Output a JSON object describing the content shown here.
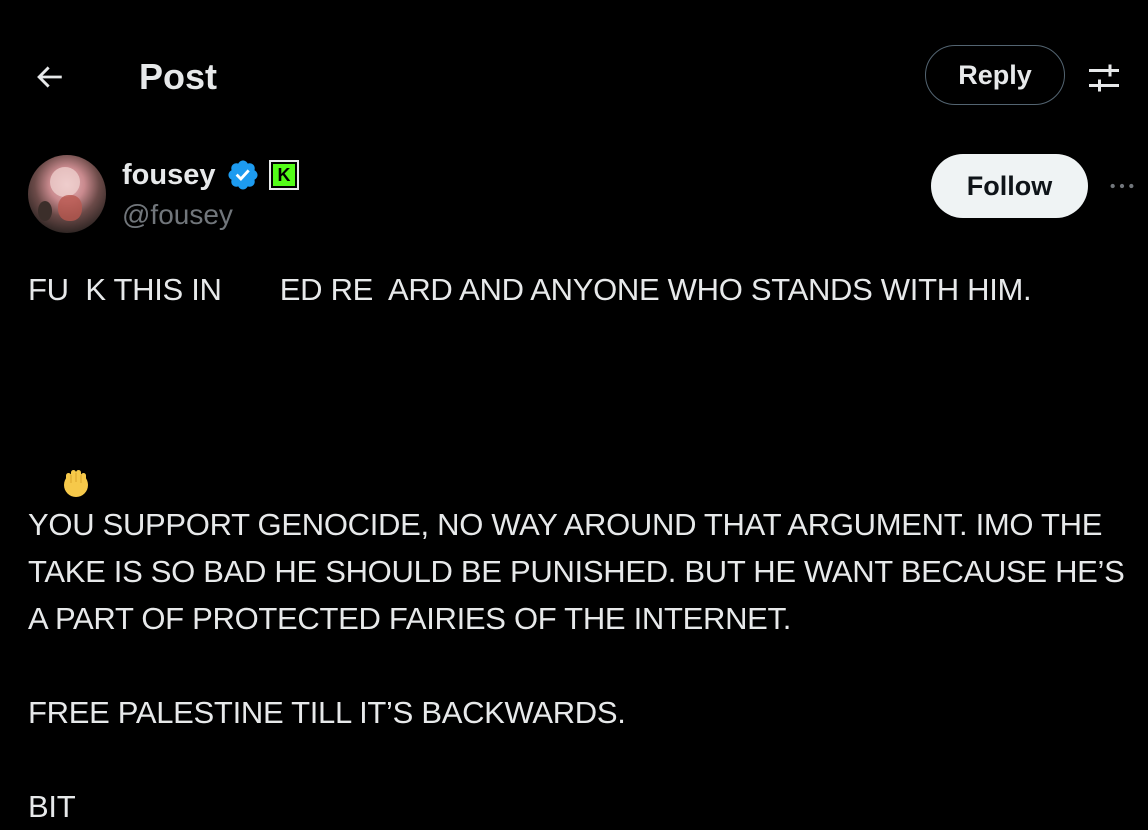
{
  "header": {
    "title": "Post",
    "reply_label": "Reply",
    "back_icon": "arrow-left-icon",
    "settings_icon": "sliders-icon"
  },
  "author": {
    "display_name": "fousey",
    "handle": "@fousey",
    "verified_icon": "verified-badge-icon",
    "affiliate_badge_icon": "kick-logo-icon",
    "follow_label": "Follow",
    "more_icon": "more-horizontal-icon"
  },
  "post": {
    "line1": "FU  K THIS IN       ED RE  ARD AND ANYONE WHO STANDS WITH HIM.",
    "emoji_icon": "raised-fist-icon",
    "para2": "YOU SUPPORT GENOCIDE, NO WAY AROUND THAT ARGUMENT. IMO THE TAKE IS SO BAD HE SHOULD BE PUNISHED. BUT HE WANT BECAUSE HE’S A PART OF PROTECTED FAIRIES OF THE INTERNET.",
    "para3": "FREE PALESTINE TILL IT’S BACKWARDS.",
    "para4": "BIT"
  },
  "colors": {
    "background": "#000000",
    "text": "#e7e9ea",
    "secondary_text": "#71767b",
    "verified_blue": "#1d9bf0",
    "kick_green": "#53fc18",
    "follow_bg": "#eff3f4"
  }
}
